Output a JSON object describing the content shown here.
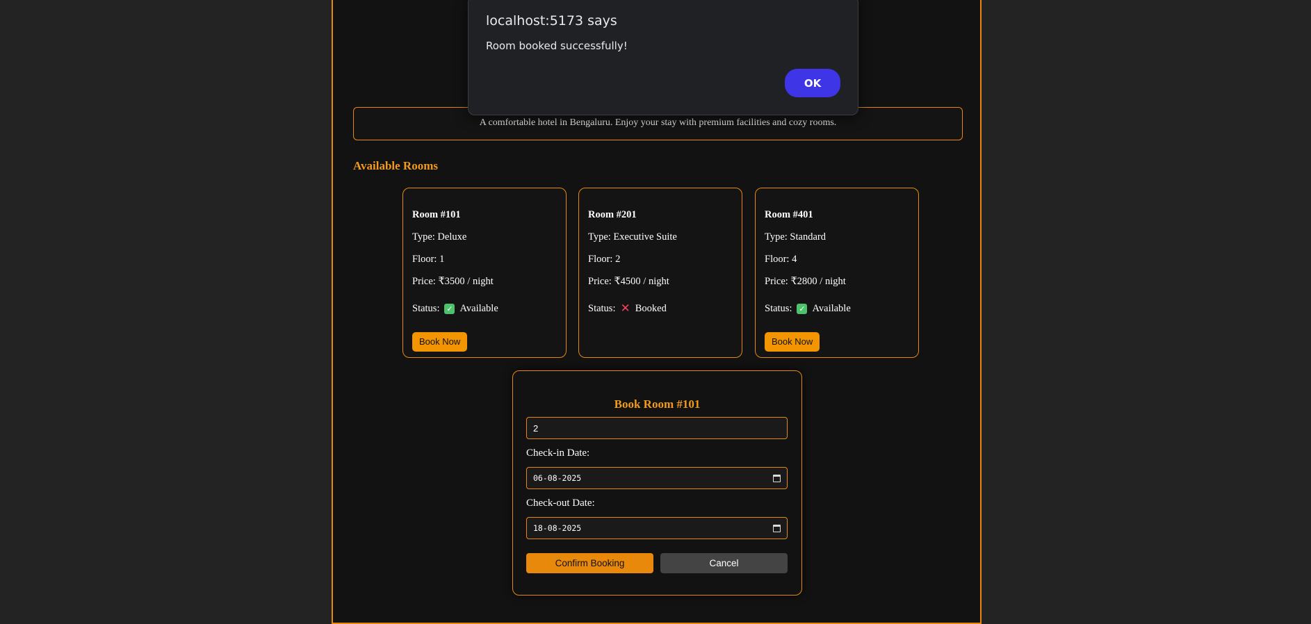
{
  "hotel": {
    "description": "A comfortable hotel in Bengaluru. Enjoy your stay with premium facilities and cozy rooms."
  },
  "rooms_section": {
    "title": "Available Rooms"
  },
  "rooms": [
    {
      "title": "Room #101",
      "type": "Type: Deluxe",
      "floor": "Floor: 1",
      "price": "Price: ₹3500 / night",
      "status_label": "Status:",
      "status": "Available",
      "status_icon": "check-icon",
      "button": "Book Now"
    },
    {
      "title": "Room #201",
      "type": "Type: Executive Suite",
      "floor": "Floor: 2",
      "price": "Price: ₹4500 / night",
      "status_label": "Status:",
      "status": "Booked",
      "status_icon": "cross-icon"
    },
    {
      "title": "Room #401",
      "type": "Type: Standard",
      "floor": "Floor: 4",
      "price": "Price: ₹2800 / night",
      "status_label": "Status:",
      "status": "Available",
      "status_icon": "check-icon",
      "button": "Book Now"
    }
  ],
  "booking": {
    "title": "Book Room #101",
    "guests_value": "2",
    "checkin_label": "Check-in Date:",
    "checkin_value": "06-08-2025",
    "checkout_label": "Check-out Date:",
    "checkout_value": "18-08-2025",
    "confirm_label": "Confirm Booking",
    "cancel_label": "Cancel"
  },
  "dialog": {
    "title": "localhost:5173 says",
    "message": "Room booked successfully!",
    "ok_label": "OK"
  },
  "colors": {
    "accent": "#e8890b",
    "background": "#121212",
    "dialog_button": "#3d35e6",
    "available": "#4dc16b",
    "booked": "#f0425d"
  }
}
